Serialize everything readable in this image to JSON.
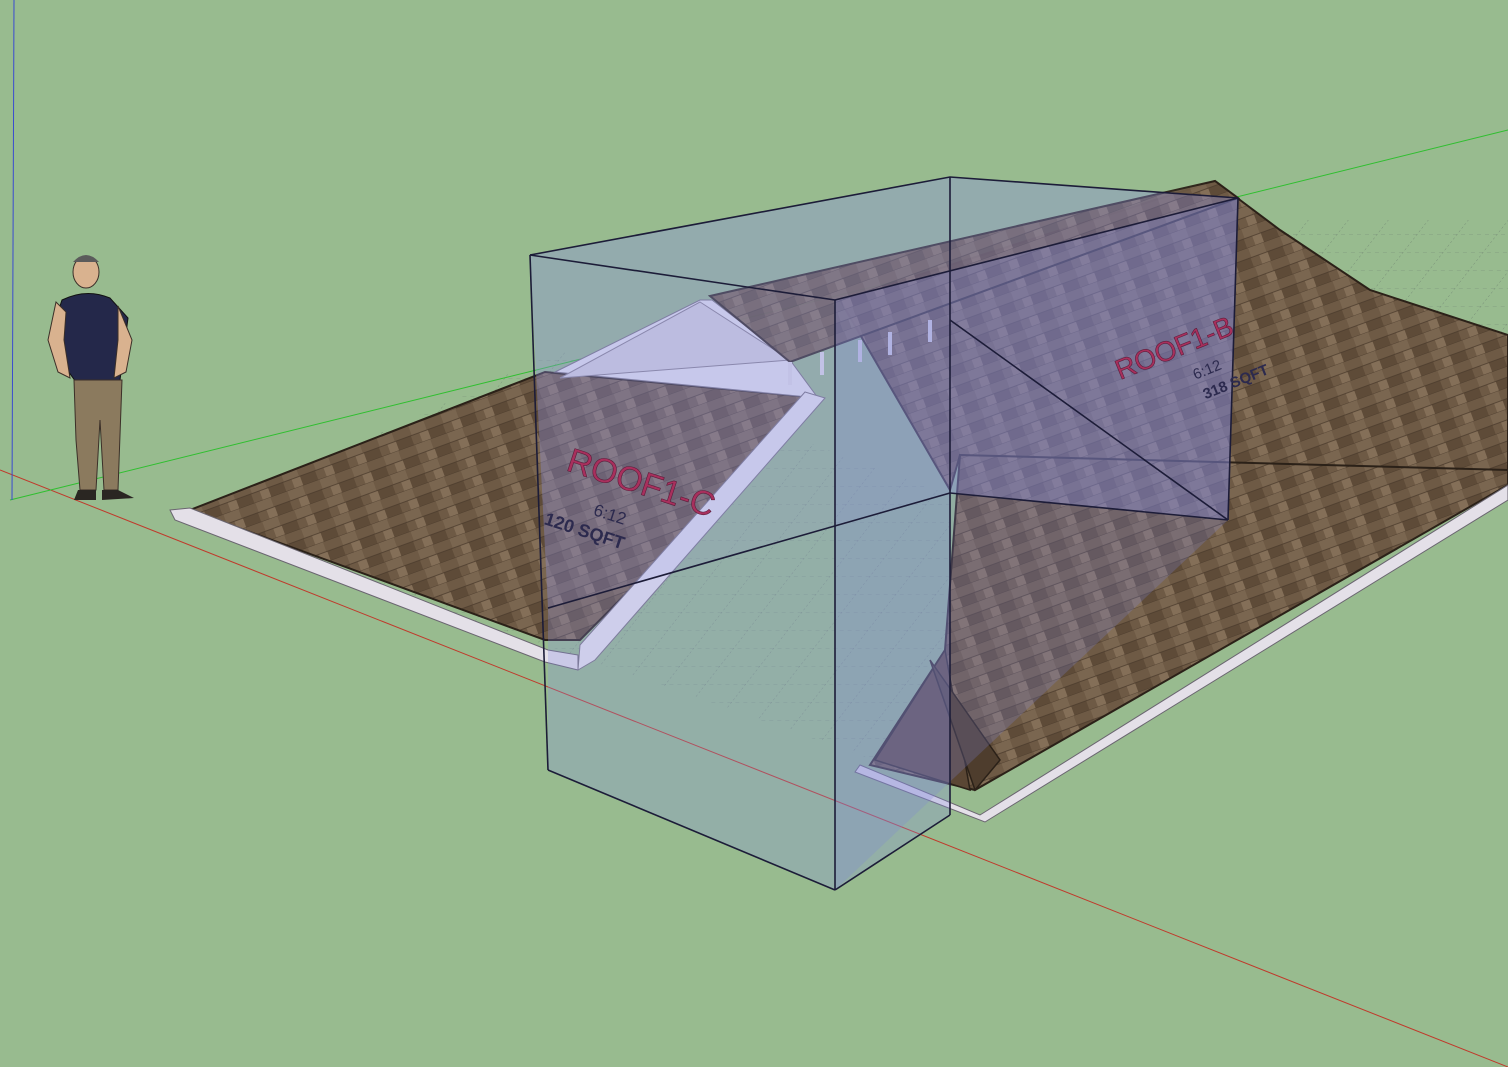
{
  "app": {
    "name": "SketchUp 3D model viewport",
    "background_color": "#98bb8f",
    "axis_colors": {
      "red": "#c0392b",
      "green": "#2fbf2f",
      "blue": "#3a4bd0"
    }
  },
  "colors": {
    "roof_shingle": "#6e5a45",
    "roof_shingle_dark": "#4e3d2d",
    "fascia": "#e4e0e8",
    "section_box_fill": "#8a8fe6",
    "section_box_edge": "#1c1c38",
    "label_name": "#a8305d",
    "label_detail": "#2c2a4e"
  },
  "roof_labels": [
    {
      "name": "ROOF1-C",
      "pitch": "6:12",
      "area": "120 SQFT"
    },
    {
      "name": "ROOF1-B",
      "pitch": "6:12",
      "area": "318 SQFT"
    }
  ],
  "entities": {
    "person": "scale-figure",
    "section_box": "section-box"
  }
}
